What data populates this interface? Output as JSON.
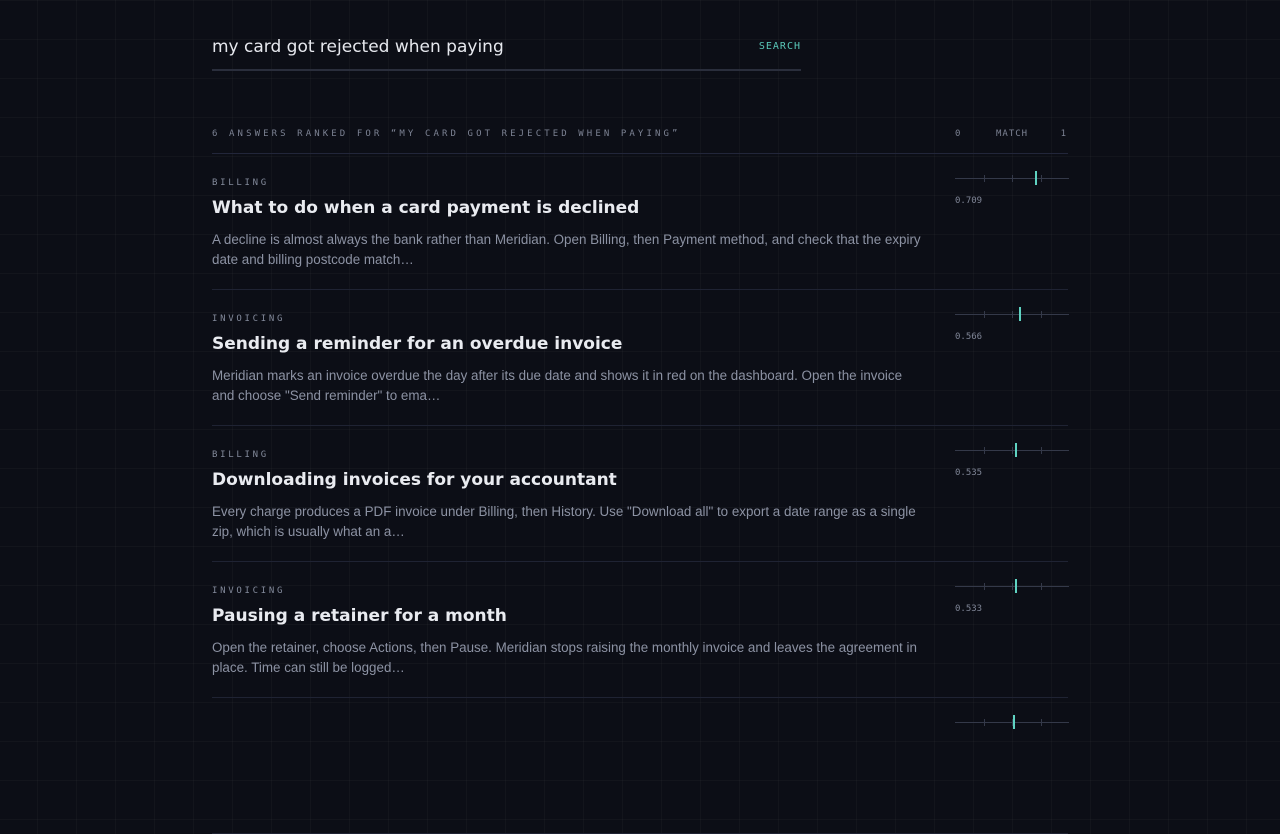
{
  "search": {
    "query": "my card got rejected when paying",
    "button_label": "SEARCH"
  },
  "results_header": {
    "count_label": "6 ANSWERS RANKED FOR “MY CARD GOT REJECTED WHEN PAYING”",
    "scale_min": "0",
    "scale_label": "MATCH",
    "scale_max": "1"
  },
  "colors": {
    "accent": "#5fd3c2",
    "background": "#0c0e16"
  },
  "results": [
    {
      "category": "BILLING",
      "title": "What to do when a card payment is declined",
      "snippet": "A decline is almost always the bank rather than Meridian. Open Billing, then Payment method, and check that the expiry date and billing postcode match…",
      "score": "0.709",
      "match": 0.709
    },
    {
      "category": "INVOICING",
      "title": "Sending a reminder for an overdue invoice",
      "snippet": "Meridian marks an invoice overdue the day after its due date and shows it in red on the dashboard. Open the invoice and choose \"Send reminder\" to ema…",
      "score": "0.566",
      "match": 0.566
    },
    {
      "category": "BILLING",
      "title": "Downloading invoices for your accountant",
      "snippet": "Every charge produces a PDF invoice under Billing, then History. Use \"Download all\" to export a date range as a single zip, which is usually what an a…",
      "score": "0.535",
      "match": 0.535
    },
    {
      "category": "INVOICING",
      "title": "Pausing a retainer for a month",
      "snippet": "Open the retainer, choose Actions, then Pause. Meridian stops raising the monthly invoice and leaves the agreement in place. Time can still be logged…",
      "score": "0.533",
      "match": 0.533
    },
    {
      "match": 0.52
    }
  ]
}
